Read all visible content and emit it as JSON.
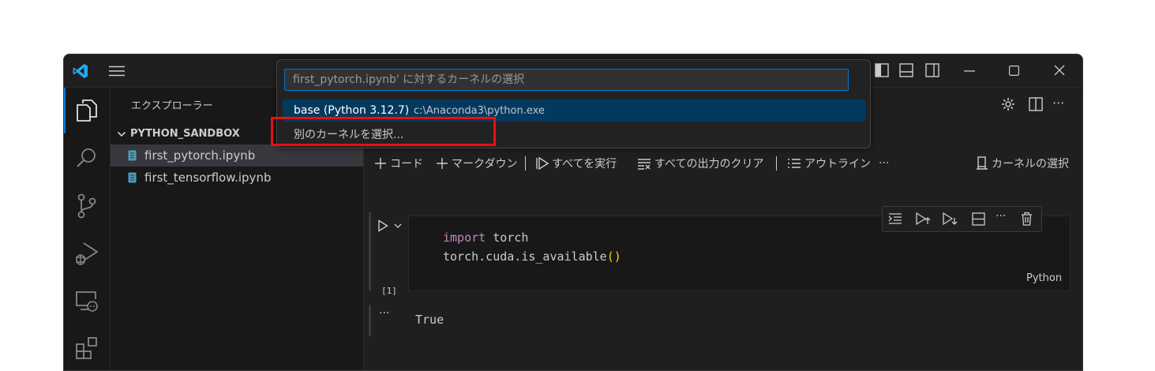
{
  "palette": {
    "placeholder": "first_pytorch.ipynb' に対するカーネルの選択",
    "items": [
      {
        "label": "base (Python 3.12.7)",
        "detail": "c:\\Anaconda3\\python.exe"
      },
      {
        "label": "別のカーネルを選択..."
      }
    ]
  },
  "sidebar": {
    "title": "エクスプローラー",
    "folder": "PYTHON_SANDBOX",
    "files": [
      "first_pytorch.ipynb",
      "first_tensorflow.ipynb"
    ]
  },
  "notebook": {
    "toolbar": {
      "code": "コード",
      "markdown": "マークダウン",
      "run_all": "すべてを実行",
      "clear_outputs": "すべての出力のクリア",
      "outline": "アウトライン",
      "more": "···",
      "select_kernel": "カーネルの選択"
    },
    "cell": {
      "line1_keyword": "import",
      "line1_rest": " torch",
      "line2_code": "torch.cuda.is_available",
      "line2_parens": "()",
      "exec_count": "[1]",
      "language": "Python",
      "output_menu": "···",
      "output": "True"
    }
  },
  "colors": {
    "accent": "#0078d4",
    "highlight": "#e81010",
    "selection": "#04395e",
    "keyword": "#c586c0",
    "bracket": "#ffd700"
  }
}
